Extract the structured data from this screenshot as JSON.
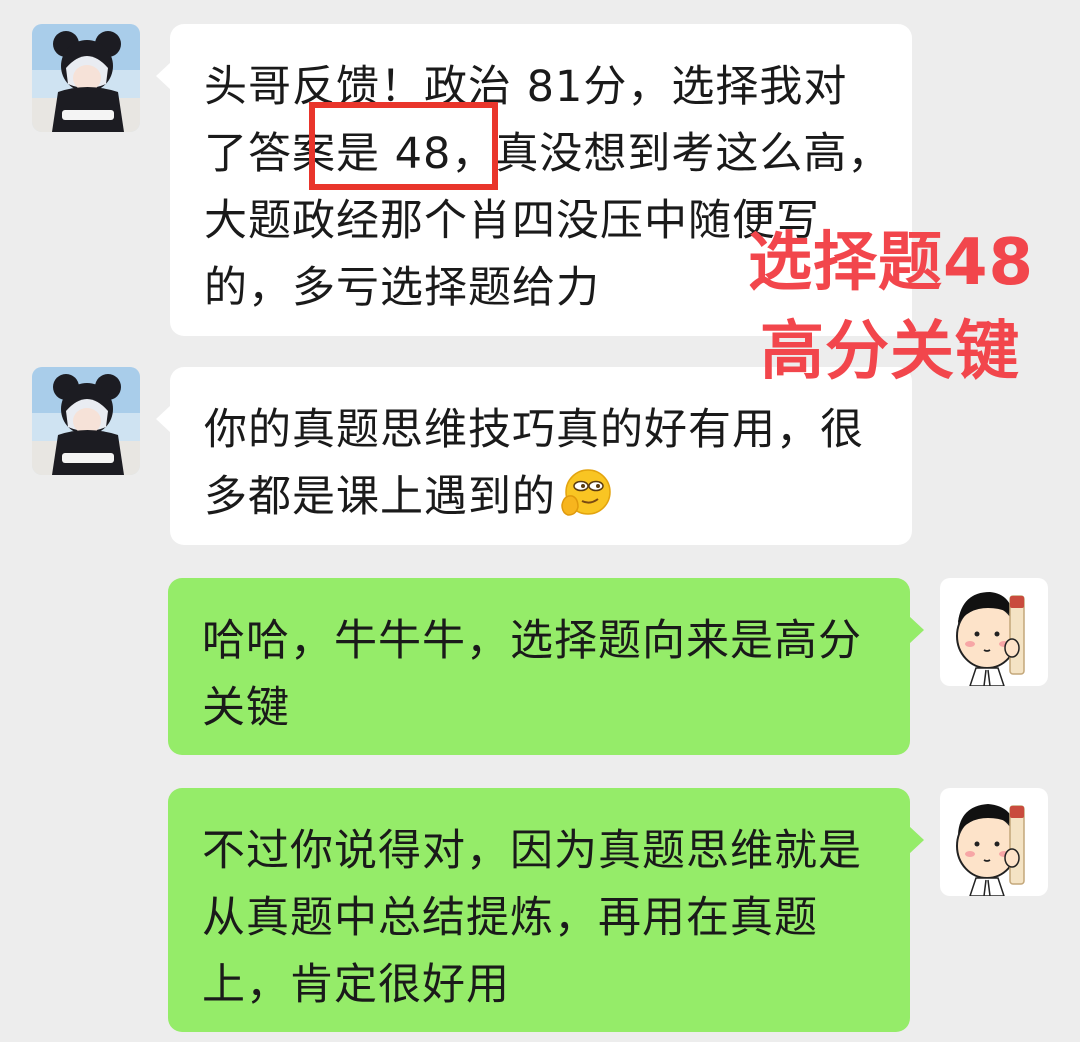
{
  "messages": [
    {
      "side": "left",
      "avatar_icon": "anime-boy-hoodie-avatar",
      "lines": [
        "头哥反馈！政治 81分，选择我对",
        "了答案是 48，真没想到考这么高，",
        "大题政经那个肖四没压中随便写",
        "的，多亏选择题给力"
      ]
    },
    {
      "side": "left",
      "avatar_icon": "anime-boy-hoodie-avatar",
      "lines": [
        "你的真题思维技巧真的好有用，很",
        "多都是课上遇到的"
      ],
      "emoji": "smirk-emoji"
    },
    {
      "side": "right",
      "avatar_icon": "cartoon-man-avatar",
      "lines": [
        "哈哈，牛牛牛，选择题向来是高分",
        "关键"
      ]
    },
    {
      "side": "right",
      "avatar_icon": "cartoon-man-avatar",
      "lines": [
        "不过你说得对，因为真题思维就是",
        "从真题中总结提炼，再用在真题",
        "上，肯定很好用"
      ]
    }
  ],
  "annotation": {
    "lines": [
      "选择题48",
      "高分关键"
    ],
    "color": "#f2464c",
    "highlight_color": "#e9352b"
  },
  "colors": {
    "background": "#ededed",
    "received_bubble": "#ffffff",
    "sent_bubble": "#95ec69"
  }
}
